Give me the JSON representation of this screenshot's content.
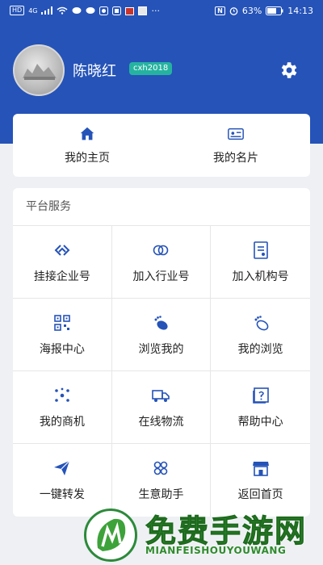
{
  "status_bar": {
    "left_chip": "HD",
    "signal_label": "4G",
    "more": "···",
    "nfc": "N",
    "battery": "63%",
    "time": "14:13"
  },
  "profile": {
    "name": "陈晓红",
    "badge": "cxh2018"
  },
  "quick_links": [
    {
      "label": "我的主页",
      "icon": "home-icon"
    },
    {
      "label": "我的名片",
      "icon": "card-icon"
    }
  ],
  "services": {
    "title": "平台服务",
    "items": [
      {
        "label": "挂接企业号",
        "icon": "link-icon"
      },
      {
        "label": "加入行业号",
        "icon": "rings-icon"
      },
      {
        "label": "加入机构号",
        "icon": "document-icon"
      },
      {
        "label": "海报中心",
        "icon": "qr-icon"
      },
      {
        "label": "浏览我的",
        "icon": "footprint-icon"
      },
      {
        "label": "我的浏览",
        "icon": "footprint-outline-icon"
      },
      {
        "label": "我的商机",
        "icon": "network-icon"
      },
      {
        "label": "在线物流",
        "icon": "truck-icon"
      },
      {
        "label": "帮助中心",
        "icon": "help-icon"
      },
      {
        "label": "一键转发",
        "icon": "paper-plane-icon"
      },
      {
        "label": "生意助手",
        "icon": "clover-icon"
      },
      {
        "label": "返回首页",
        "icon": "store-icon"
      }
    ]
  },
  "watermark": {
    "title": "免费手游网",
    "subtitle": "MIANFEISHOUYOUWANG"
  },
  "colors": {
    "header": "#2553b8",
    "icon": "#2553b8",
    "badge": "#25b3a0",
    "watermark": "#2f8b2d"
  }
}
